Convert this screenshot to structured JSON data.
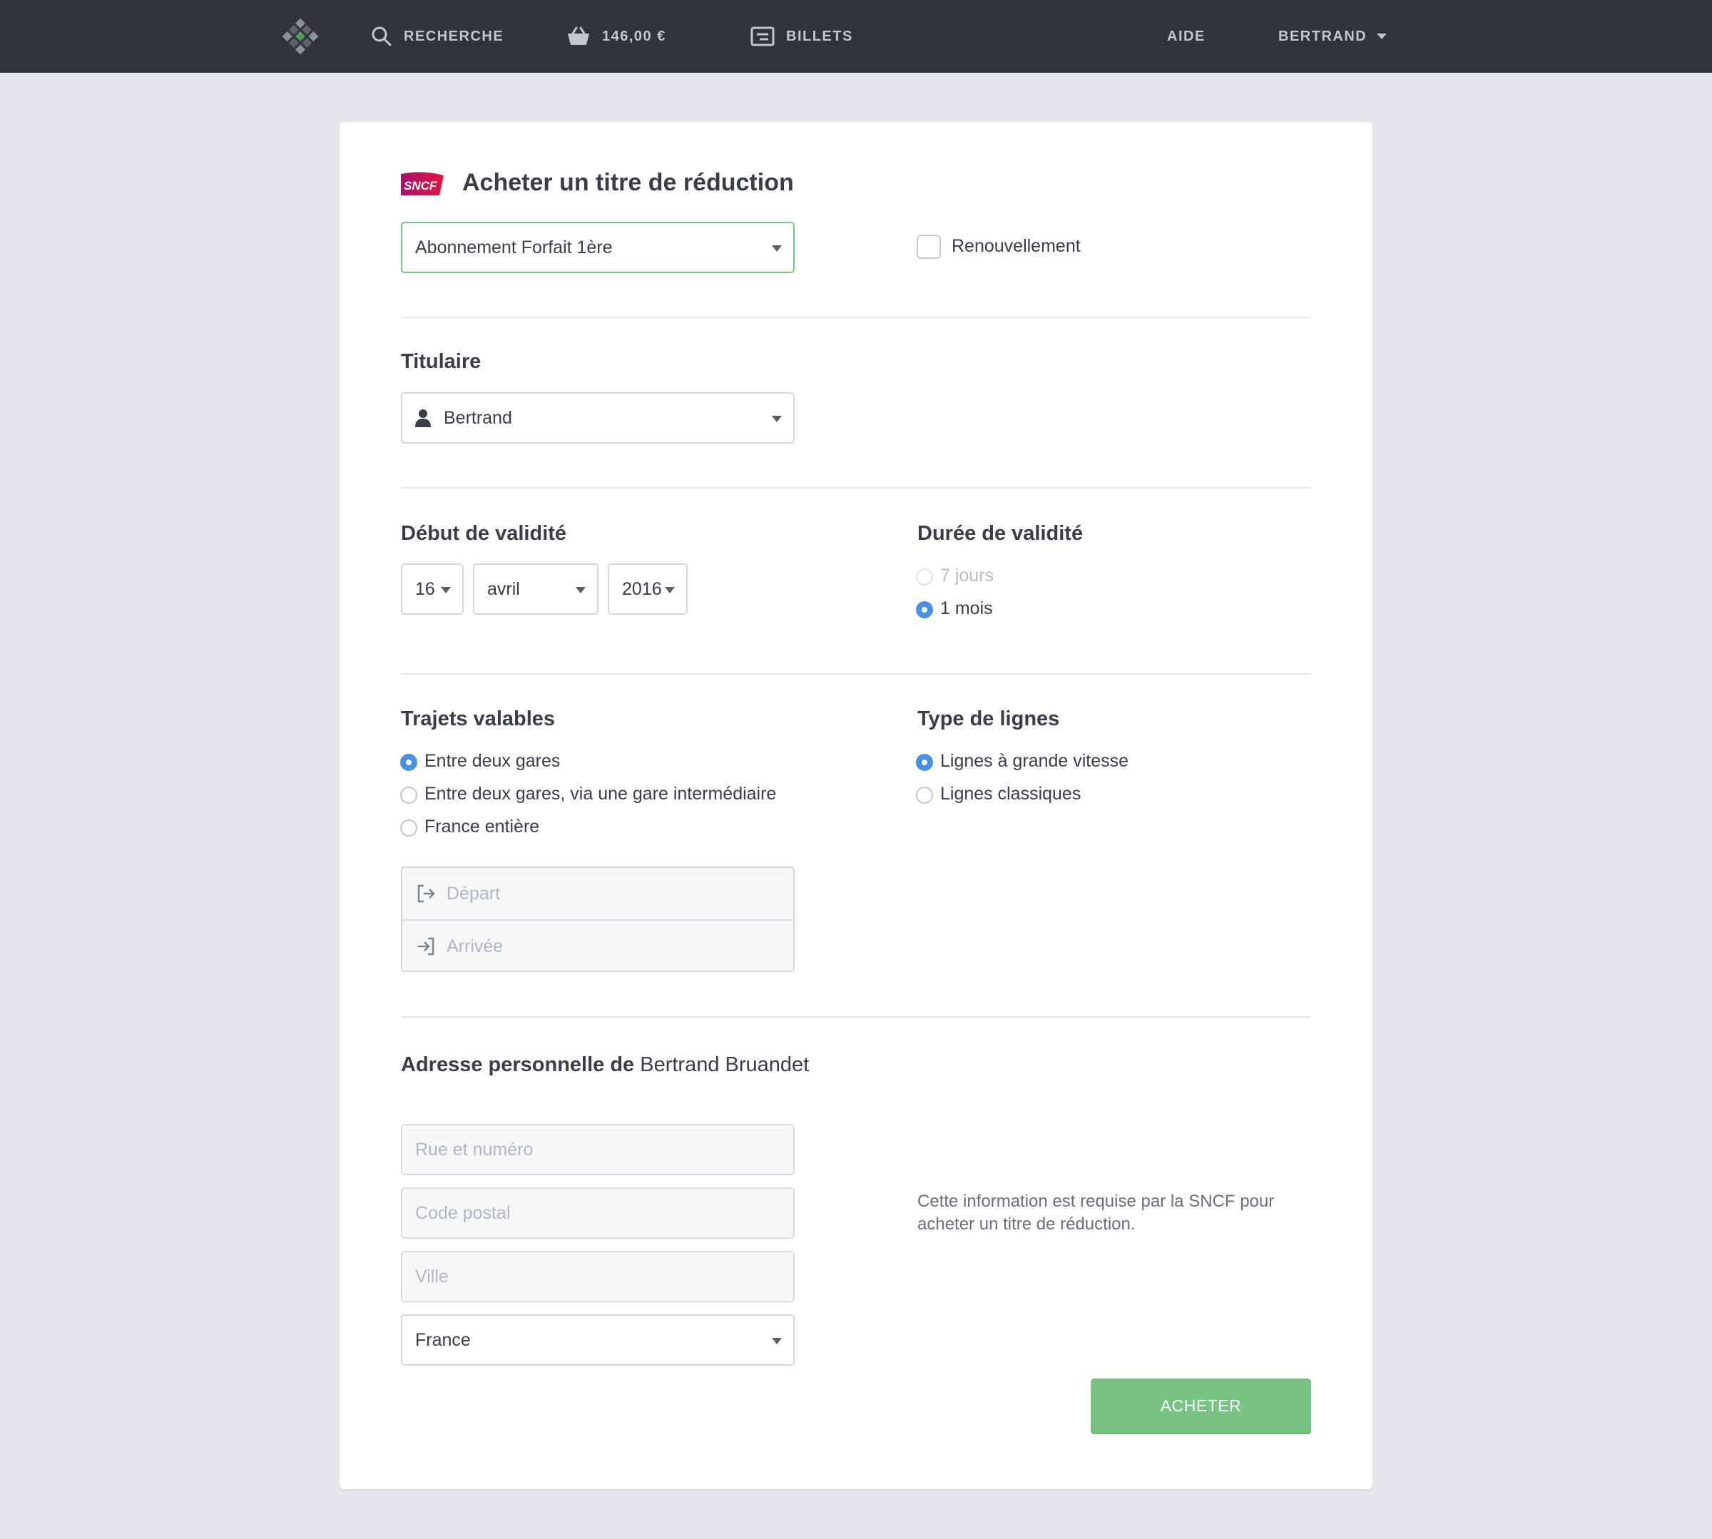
{
  "nav": {
    "search_label": "RECHERCHE",
    "cart_amount": "146,00 €",
    "tickets_label": "BILLETS",
    "help_label": "AIDE",
    "user_label": "BERTRAND"
  },
  "header": {
    "logo_text": "SNCF",
    "title": "Acheter un titre de réduction"
  },
  "product": {
    "selected": "Abonnement Forfait 1ère",
    "renewal_label": "Renouvellement",
    "renewal_checked": false
  },
  "holder": {
    "title": "Titulaire",
    "selected": "Bertrand"
  },
  "validity_start": {
    "title": "Début de validité",
    "day": "16",
    "month": "avril",
    "year": "2016"
  },
  "validity_duration": {
    "title": "Durée de validité",
    "options": [
      {
        "label": "7 jours",
        "state": "disabled"
      },
      {
        "label": "1 mois",
        "state": "checked"
      }
    ]
  },
  "journeys": {
    "title": "Trajets valables",
    "options": [
      {
        "label": "Entre deux gares",
        "checked": true
      },
      {
        "label": "Entre deux gares, via une gare intermédiaire",
        "checked": false
      },
      {
        "label": "France entière",
        "checked": false
      }
    ],
    "departure_placeholder": "Départ",
    "arrival_placeholder": "Arrivée"
  },
  "line_type": {
    "title": "Type de lignes",
    "options": [
      {
        "label": "Lignes à grande vitesse",
        "checked": true
      },
      {
        "label": "Lignes classiques",
        "checked": false
      }
    ]
  },
  "address": {
    "title_bold": "Adresse personnelle de",
    "title_name": "Bertrand Bruandet",
    "street_placeholder": "Rue et numéro",
    "postcode_placeholder": "Code postal",
    "city_placeholder": "Ville",
    "country": "France",
    "info": "Cette information est requise par la SNCF pour acheter un titre de réduction."
  },
  "actions": {
    "buy_label": "ACHETER"
  },
  "colors": {
    "nav_bg": "#30333b",
    "page_bg": "#e6e7ea",
    "accent_blue": "#4a90e2",
    "buy_green": "#76c383",
    "focus_green": "#7cc286"
  }
}
